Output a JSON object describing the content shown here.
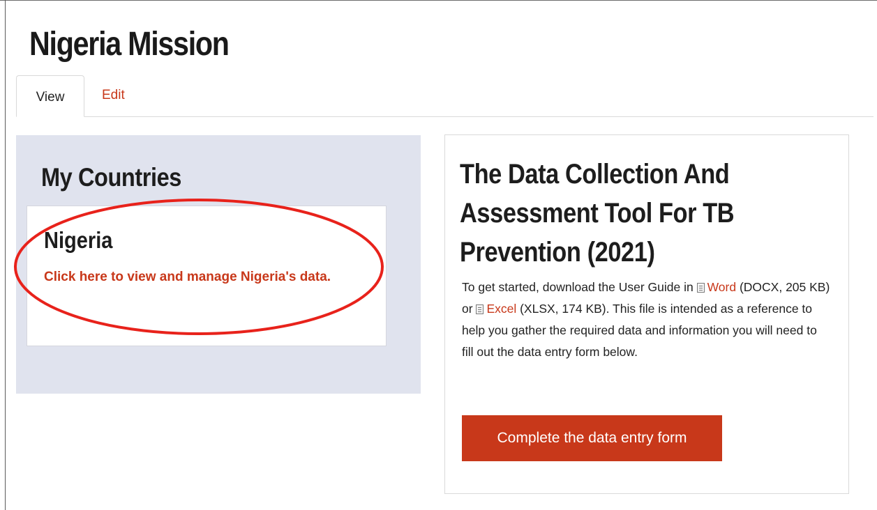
{
  "page": {
    "title": "Nigeria Mission"
  },
  "tabs": [
    {
      "label": "View",
      "active": true
    },
    {
      "label": "Edit",
      "active": false
    }
  ],
  "countries": {
    "heading": "My Countries",
    "items": [
      {
        "name": "Nigeria",
        "link": "Click here to view and manage Nigeria's data."
      }
    ]
  },
  "tool": {
    "title": "The Data Collection And Assessment Tool For TB Prevention (2021)",
    "intro": "To get started, download the User Guide in ",
    "word_label": "Word",
    "word_meta": " (DOCX, 205 KB) or ",
    "excel_label": "Excel",
    "excel_meta": " (XLSX, 174 KB). This file is intended as a reference to help you gather the required data and information you will need to fill out the data entry form below.",
    "word_icon": "document-icon",
    "excel_icon": "document-icon",
    "button_label": "Complete the data entry form"
  },
  "colors": {
    "accent": "#c8381a",
    "panel_bg": "#e0e3ee",
    "annotation": "#e8221b"
  }
}
